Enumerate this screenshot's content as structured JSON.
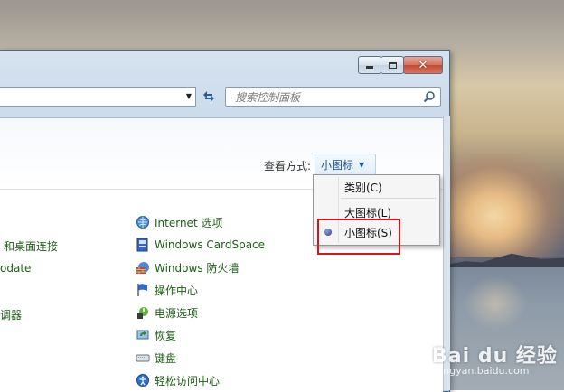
{
  "search": {
    "placeholder": "搜索控制面板"
  },
  "view_by": {
    "label": "查看方式:",
    "current": "小图标"
  },
  "view_menu": {
    "items": [
      {
        "label": "类别(C)"
      },
      {
        "label": "大图标(L)"
      },
      {
        "label": "小图标(S)"
      }
    ],
    "selected_index": 2
  },
  "left_column": [
    "和桌面连接",
    "odate",
    "调器"
  ],
  "right_column": [
    {
      "label": "Internet 选项",
      "icon": "internet-options-icon"
    },
    {
      "label": "Windows CardSpace",
      "icon": "cardspace-icon"
    },
    {
      "label": "Windows 防火墙",
      "icon": "firewall-icon"
    },
    {
      "label": "操作中心",
      "icon": "action-center-flag-icon"
    },
    {
      "label": "电源选项",
      "icon": "power-options-icon"
    },
    {
      "label": "恢复",
      "icon": "recovery-icon"
    },
    {
      "label": "键盘",
      "icon": "keyboard-icon"
    },
    {
      "label": "轻松访问中心",
      "icon": "ease-of-access-icon"
    }
  ],
  "watermark": {
    "logo": "Bai du 经验",
    "url": "jingyan.baidu.com"
  },
  "colors": {
    "link": "#1d5f16",
    "highlight_box": "#d4151d",
    "menu_link": "#1c5291"
  }
}
